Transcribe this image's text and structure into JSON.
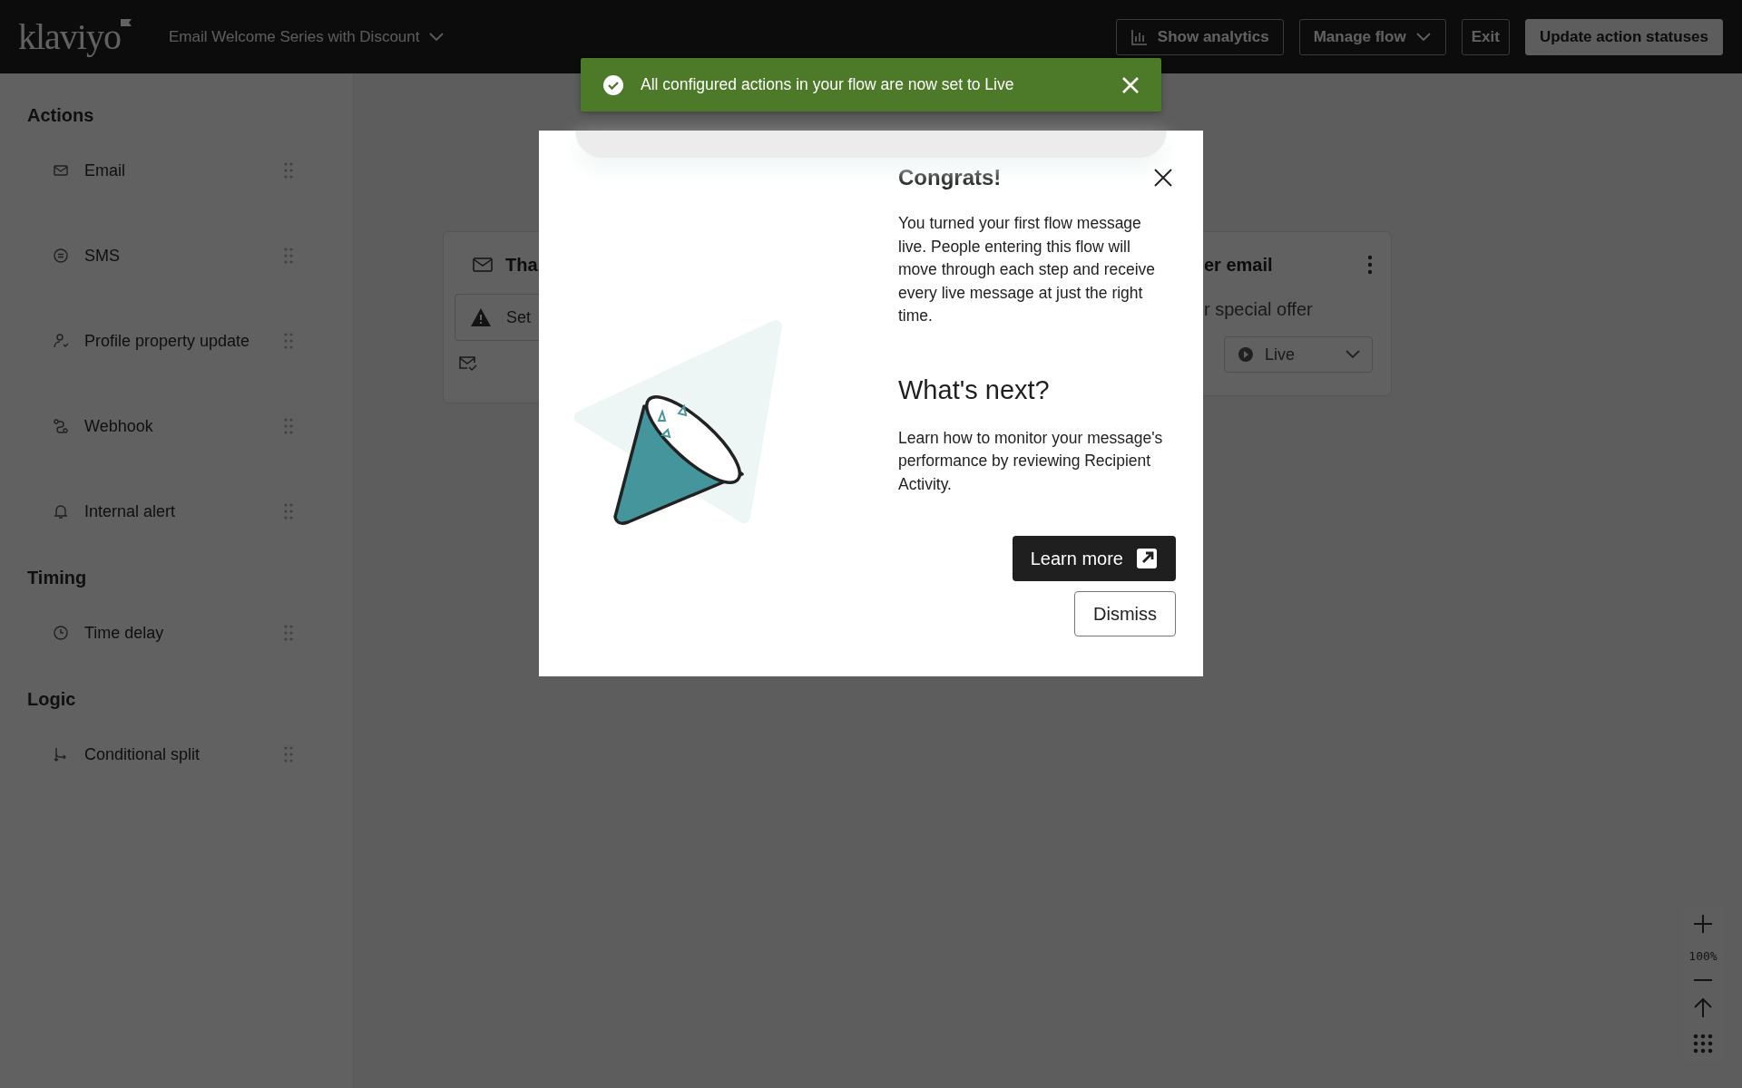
{
  "topbar": {
    "logo": "klaviyo",
    "flow_name": "Email Welcome Series with Discount",
    "buttons": [
      {
        "label": "Show analytics",
        "kind": "analytics"
      },
      {
        "label": "Manage flow",
        "kind": "dropdown"
      },
      {
        "label": "Exit",
        "kind": "plain"
      },
      {
        "label": "Update action statuses",
        "kind": "primary"
      }
    ]
  },
  "toast": {
    "message": "All configured actions in your flow are now set to Live"
  },
  "sidebar": {
    "sections": [
      {
        "title": "Actions",
        "items": [
          {
            "label": "Email",
            "kind": "email"
          },
          {
            "label": "SMS",
            "kind": "sms"
          },
          {
            "label": "Profile property update",
            "kind": "profile"
          },
          {
            "label": "Webhook",
            "kind": "webhook"
          },
          {
            "label": "Internal alert",
            "kind": "alert"
          }
        ]
      },
      {
        "title": "Timing",
        "items": [
          {
            "label": "Time delay",
            "kind": "delay"
          }
        ]
      },
      {
        "title": "Logic",
        "items": [
          {
            "label": "Conditional split",
            "kind": "split"
          }
        ]
      }
    ]
  },
  "canvas": {
    "nodes": [
      {
        "kind": "warning",
        "title": "Tha",
        "warning": "Set"
      },
      {
        "kind": "live",
        "title": "er email",
        "subtitle": "r special offer",
        "status": "Live"
      }
    ],
    "zoom_text": "100%"
  },
  "modal": {
    "title": "Congrats!",
    "body": "You turned your first flow message live. People entering this flow will move through each step and receive every live message at just the right time.",
    "next_title": "What's next?",
    "next_body": "Learn how to monitor your message's performance by reviewing Recipient Activity.",
    "buttons": [
      {
        "label": "Learn more",
        "kind": "primary"
      },
      {
        "label": "Dismiss",
        "kind": "secondary"
      }
    ]
  }
}
